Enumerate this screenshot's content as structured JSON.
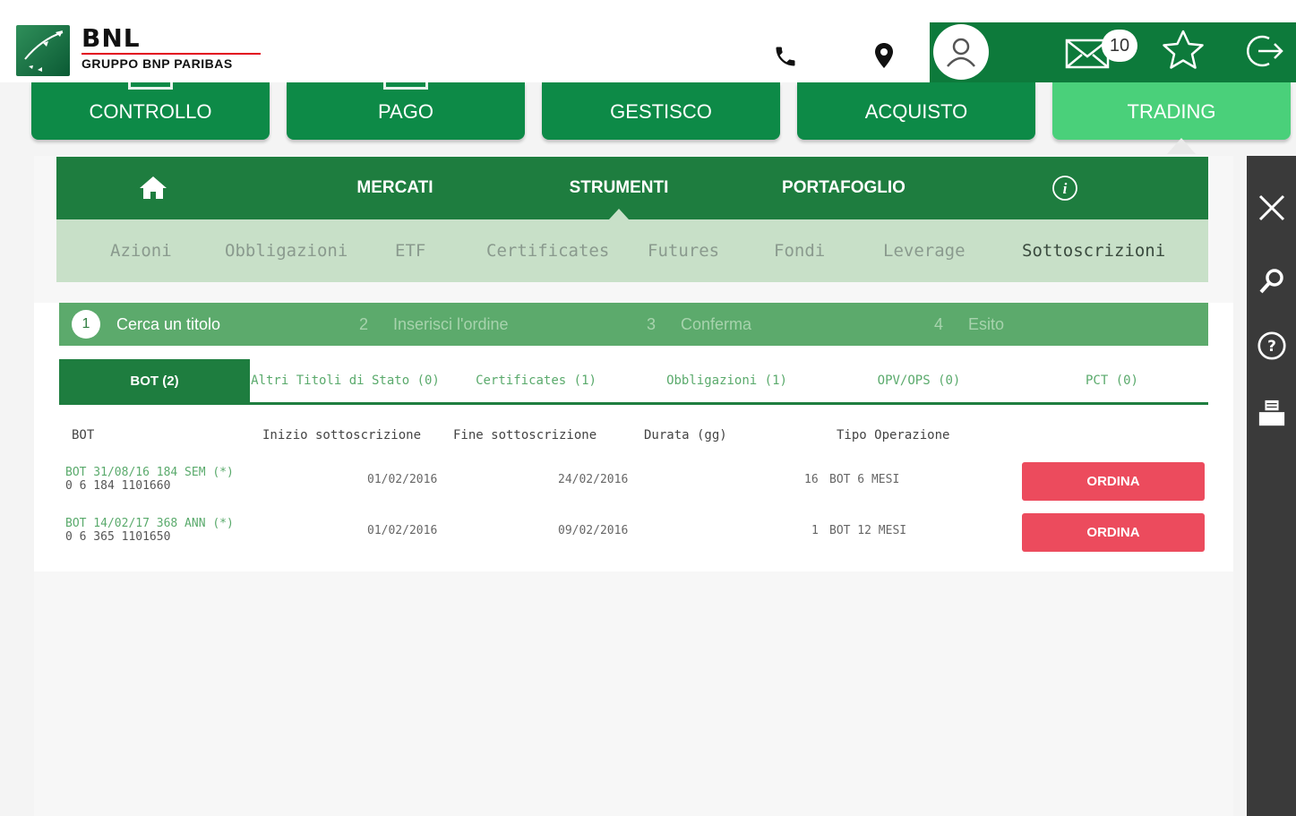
{
  "brand": {
    "name": "BNL",
    "group": "GRUPPO BNP PARIBAS"
  },
  "header": {
    "notification_count": "10"
  },
  "main_tabs": [
    {
      "label": "CONTROLLO"
    },
    {
      "label": "PAGO"
    },
    {
      "label": "GESTISCO"
    },
    {
      "label": "ACQUISTO"
    },
    {
      "label": "TRADING"
    }
  ],
  "trading_nav": [
    {
      "label": "MERCATI"
    },
    {
      "label": "STRUMENTI"
    },
    {
      "label": "PORTAFOGLIO"
    }
  ],
  "subnav": [
    {
      "label": "Azioni"
    },
    {
      "label": "Obbligazioni"
    },
    {
      "label": "ETF"
    },
    {
      "label": "Certificates"
    },
    {
      "label": "Futures"
    },
    {
      "label": "Fondi"
    },
    {
      "label": "Leverage"
    },
    {
      "label": "Sottoscrizioni"
    }
  ],
  "steps": [
    {
      "num": "1",
      "label": "Cerca un titolo"
    },
    {
      "num": "2",
      "label": "Inserisci l'ordine"
    },
    {
      "num": "3",
      "label": "Conferma"
    },
    {
      "num": "4",
      "label": "Esito"
    }
  ],
  "categories": [
    {
      "label": "BOT (2)"
    },
    {
      "label": "Altri Titoli di Stato (0)"
    },
    {
      "label": "Certificates (1)"
    },
    {
      "label": "Obbligazioni (1)"
    },
    {
      "label": "OPV/OPS (0)"
    },
    {
      "label": "PCT (0)"
    }
  ],
  "table": {
    "headers": [
      "BOT",
      "Inizio sottoscrizione",
      "Fine sottoscrizione",
      "Durata (gg)",
      "Tipo Operazione"
    ],
    "rows": [
      {
        "name": "BOT 31/08/16 184 SEM (*)",
        "code": "0 6 184 1101660",
        "start": "01/02/2016",
        "end": "24/02/2016",
        "duration": "16",
        "type": "BOT 6 MESI",
        "action": "ORDINA"
      },
      {
        "name": "BOT 14/02/17 368 ANN (*)",
        "code": "0 6 365 1101650",
        "start": "01/02/2016",
        "end": "09/02/2016",
        "duration": "1",
        "type": "BOT 12 MESI",
        "action": "ORDINA"
      }
    ]
  },
  "colors": {
    "brand_green": "#0d7a3b",
    "tab_green": "#0d8a47",
    "active_tab": "#4ad07a",
    "order_button": "#ec4b5d",
    "sidebar": "#3a3a3a"
  }
}
